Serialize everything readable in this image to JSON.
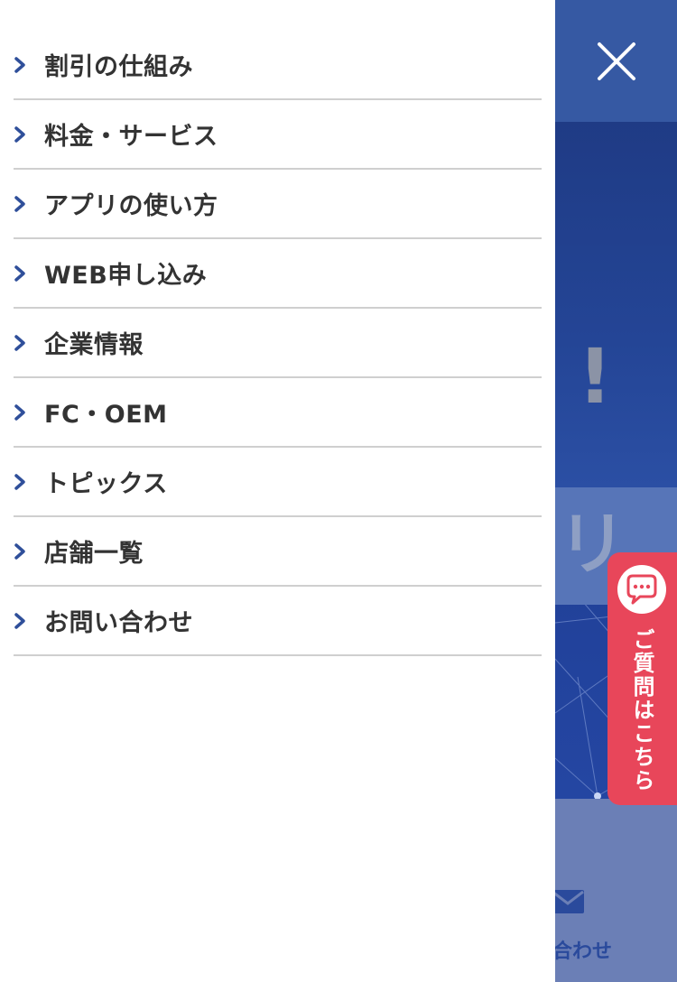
{
  "menu": {
    "items": [
      {
        "label": "割引の仕組み"
      },
      {
        "label": "料金・サービス"
      },
      {
        "label": "アプリの使い方"
      },
      {
        "label": "WEB申し込み"
      },
      {
        "label": "企業情報"
      },
      {
        "label": "FC・OEM"
      },
      {
        "label": "トピックス"
      },
      {
        "label": "店舗一覧"
      },
      {
        "label": "お問い合わせ"
      }
    ]
  },
  "background": {
    "hero_mark": "!",
    "light_mark": "リ",
    "contact_label": "い合わせ"
  },
  "question_tab": {
    "label": "ご質問はこちら"
  },
  "icons": {
    "close": "close-icon",
    "chevron": "chevron-right-icon",
    "chat": "chat-bubble-icon",
    "mail": "mail-icon"
  },
  "colors": {
    "brand_blue": "#3659a3",
    "accent_red": "#e8465a",
    "chevron": "#2f4f9a",
    "menu_text": "#333333"
  }
}
